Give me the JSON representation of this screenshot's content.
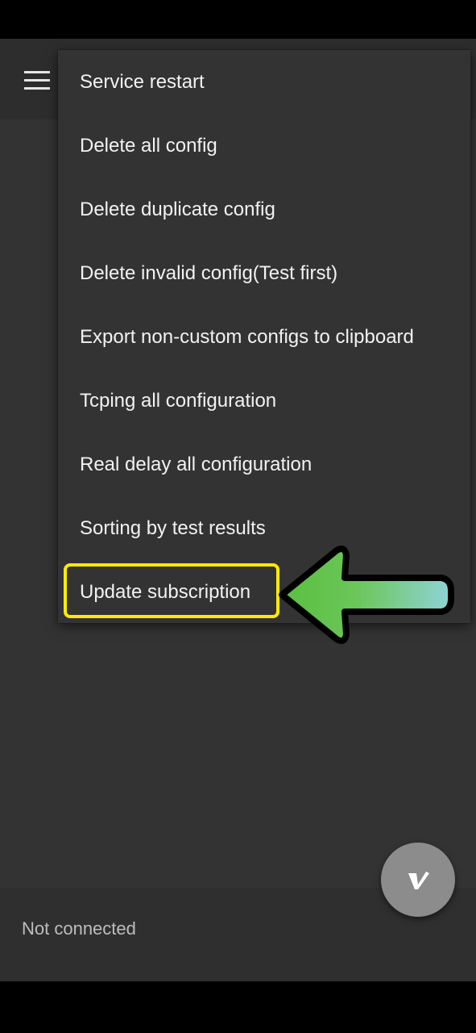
{
  "menu": {
    "items": [
      {
        "label": "Service restart"
      },
      {
        "label": "Delete all config"
      },
      {
        "label": "Delete duplicate config"
      },
      {
        "label": "Delete invalid config(Test first)"
      },
      {
        "label": "Export non-custom configs to clipboard"
      },
      {
        "label": "Tcping all configuration"
      },
      {
        "label": "Real delay all configuration"
      },
      {
        "label": "Sorting by test results"
      },
      {
        "label": "Update subscription"
      }
    ]
  },
  "toolbar": {
    "menu_icon": "hamburger-icon"
  },
  "footer": {
    "status_text": "Not connected"
  },
  "fab": {
    "icon": "v-logo-icon"
  },
  "annotation": {
    "highlight_color": "#ffeb00",
    "arrow_colors": [
      "#58c040",
      "#8fd3d8"
    ]
  },
  "colors": {
    "background": "#333333",
    "toolbar": "#2d2d2d",
    "fab": "#8c8c8c"
  }
}
